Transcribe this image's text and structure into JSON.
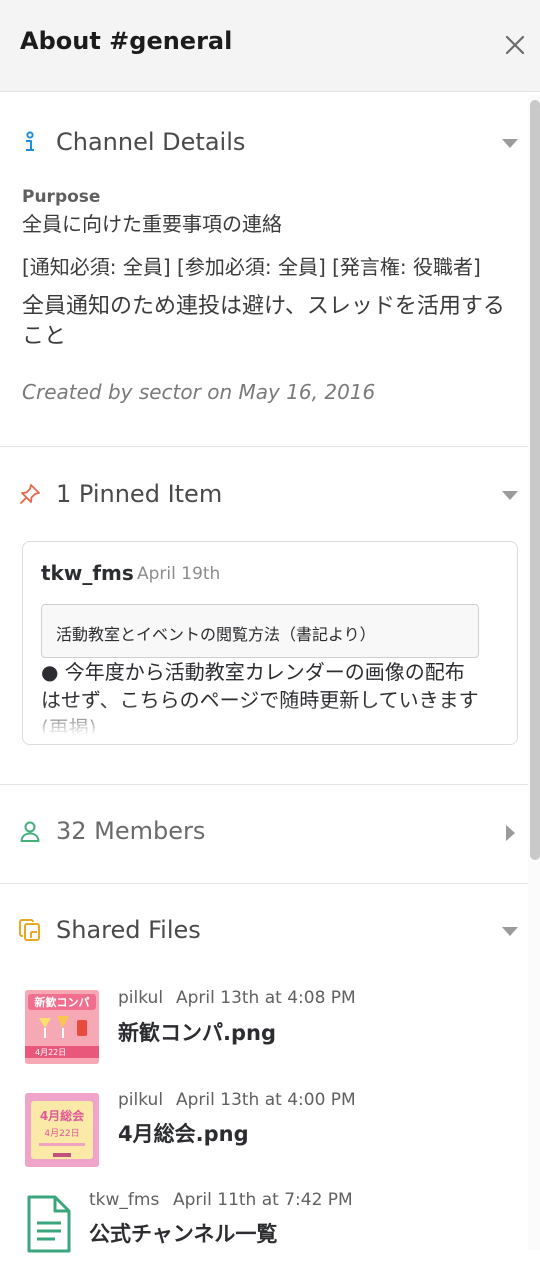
{
  "header": {
    "title": "About #general"
  },
  "details": {
    "title": "Channel Details",
    "purpose_label": "Purpose",
    "purpose_lines": [
      "全員に向けた重要事項の連絡",
      "[通知必須: 全員] [参加必須: 全員] [発言権: 役職者]",
      "全員通知のため連投は避け、スレッドを活用すること"
    ],
    "created": "Created by sector on May 16, 2016"
  },
  "pinned": {
    "title": "1 Pinned Item",
    "item": {
      "user": "tkw_fms",
      "date": "April 19th",
      "attachment": "活動教室とイベントの閲覧方法（書記より）",
      "body": "● 今年度から活動教室カレンダーの画像の配布はせず、こちらのページで随時更新していきます(再掲)"
    }
  },
  "members": {
    "title": "32 Members"
  },
  "files": {
    "title": "Shared Files",
    "items": [
      {
        "user": "pilkul",
        "time": "April 13th at 4:08 PM",
        "name": "新歓コンパ.png",
        "thumb_text": "新歓コンパ",
        "thumb_date": "4月22日"
      },
      {
        "user": "pilkul",
        "time": "April 13th at 4:00 PM",
        "name": "4月総会.png",
        "thumb_text": "4月総会",
        "thumb_date": "4月22日"
      },
      {
        "user": "tkw_fms",
        "time": "April 11th at 7:42 PM",
        "name": "公式チャンネル一覧"
      }
    ]
  },
  "icons": {
    "close": "close-icon",
    "info": "info-icon",
    "pin": "pin-icon",
    "members": "person-icon",
    "files": "files-icon",
    "doc": "document-icon"
  },
  "colors": {
    "info": "#1a8fe0",
    "pin": "#e8694a",
    "members": "#43b07c",
    "files": "#e9a820",
    "doc": "#3aa67d"
  }
}
